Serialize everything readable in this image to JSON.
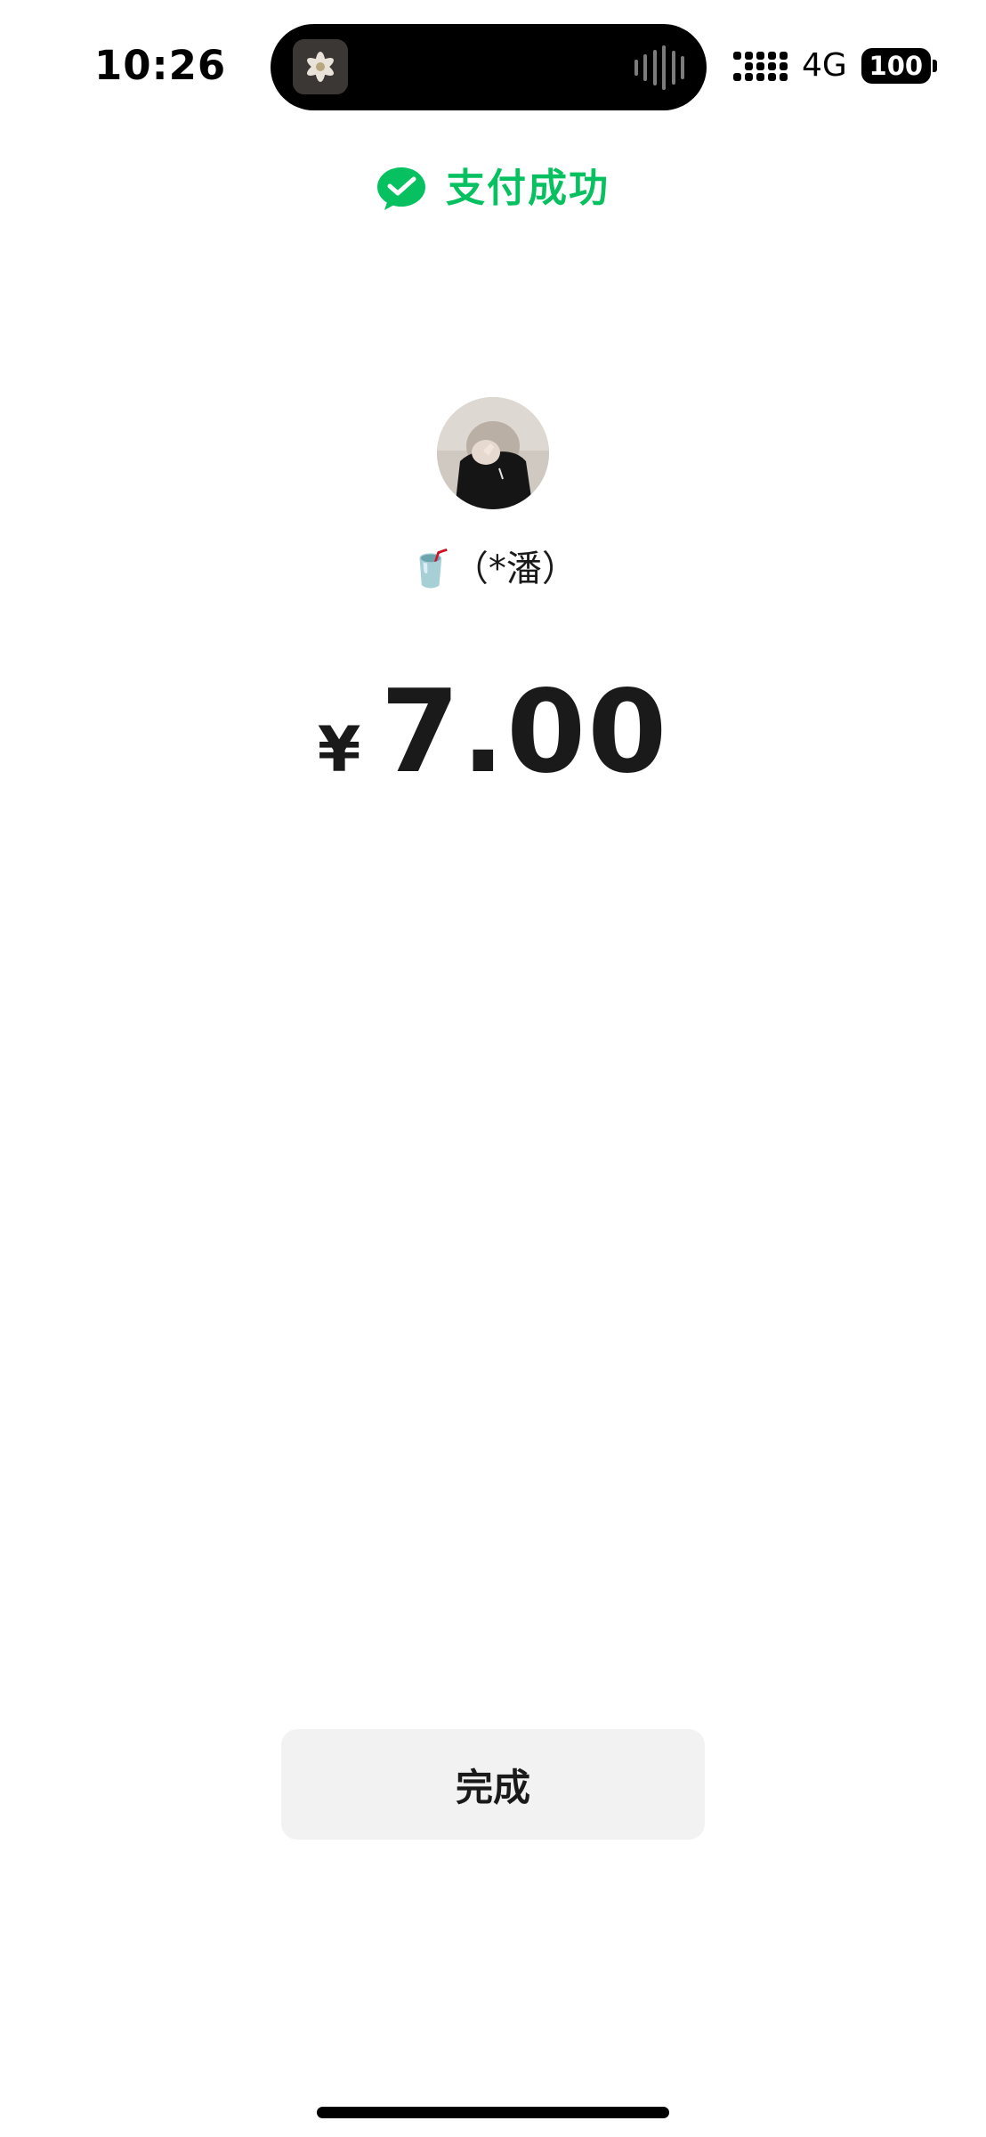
{
  "status_bar": {
    "time": "10:26",
    "network": "4G",
    "battery": "100"
  },
  "header": {
    "icon": "wechat-pay-icon",
    "title": "支付成功"
  },
  "payee": {
    "name": "🥤（*潘）"
  },
  "payment": {
    "currency": "¥",
    "amount": "7.00"
  },
  "actions": {
    "done_label": "完成"
  },
  "colors": {
    "accent": "#07c160",
    "button_bg": "#f2f2f2",
    "text": "#1a1a1a"
  }
}
